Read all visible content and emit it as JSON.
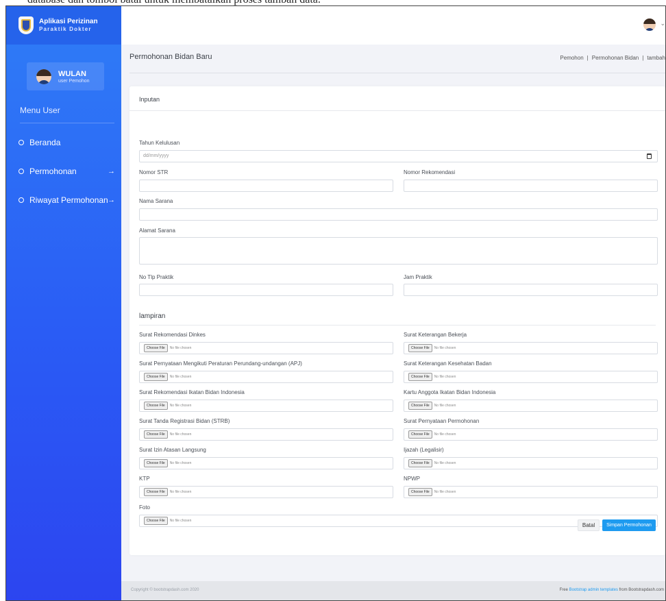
{
  "caption": "database dan tombol batal untuk membatalkan proses tambah data.",
  "brand": {
    "title": "Aplikasi Perizinan",
    "subtitle": "Paraktik Dokter"
  },
  "user": {
    "name": "WULAN",
    "role": "user Pemohon"
  },
  "menu": {
    "heading": "Menu User",
    "items": [
      {
        "label": "Beranda",
        "arrow": ""
      },
      {
        "label": "Permohonan",
        "arrow": "→"
      },
      {
        "label": "Riwayat Permohonan",
        "arrow": "→"
      }
    ]
  },
  "topbar": {
    "chevron": "⌄"
  },
  "page": {
    "title": "Permohonan Bidan Baru",
    "breadcrumb": [
      "Pemohon",
      "Permohonan Bidan",
      "tambah"
    ]
  },
  "form": {
    "header": "Inputan",
    "fields": {
      "tahun_kelulusan": {
        "label": "Tahun Kelulusan",
        "placeholder": "dd/mm/yyyy"
      },
      "nomor_str": {
        "label": "Nomor STR"
      },
      "nomor_rekomendasi": {
        "label": "Nomor Rekomendasi"
      },
      "nama_sarana": {
        "label": "Nama Sarana"
      },
      "alamat_sarana": {
        "label": "Alamat Sarana"
      },
      "no_tlp_praktik": {
        "label": "No Tlp Praktik"
      },
      "jam_praktik": {
        "label": "Jam Praktik"
      }
    },
    "lampiran_title": "lampiran",
    "file_button": "Choose File",
    "file_status": "No file chosen",
    "attachments": [
      "Surat Rekomendasi Dinkes",
      "Surat Keterangan Bekerja",
      "Surat Pernyataan Mengikuti Peraturan Perundang-undangan (APJ)",
      "Surat Keterangan Kesehatan Badan",
      "Surat Rekomendasi Ikatan Bidan Indonesia",
      "Kartu Anggota Ikatan Bidan Indonesia",
      "Surat Tanda Registrasi Bidan (STRB)",
      "Surat Pernyataan Permohonan",
      "Surat Izin Atasan Langsung",
      "Ijazah (Legalisir)",
      "KTP",
      "NPWP",
      "Foto"
    ],
    "cancel_label": "Batal",
    "submit_label": "Simpan Permohonan"
  },
  "footer": {
    "copyright": "Copyright © bootstrapdash.com 2020",
    "credit_prefix": "Free",
    "credit_link": "Bootstrap admin templates",
    "credit_suffix": "from Bootstrapdash.com"
  },
  "colors": {
    "sidebar": "#2a5cf5",
    "accent": "#1e9bf0",
    "background": "#f2f3f8"
  }
}
